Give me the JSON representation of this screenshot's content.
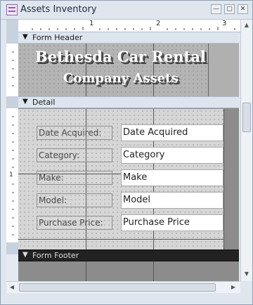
{
  "window": {
    "title": "Assets Inventory"
  },
  "window_controls": {
    "minimize": "—",
    "restore": "▢",
    "close": "✕"
  },
  "ruler": {
    "top_marks": [
      "1",
      "2",
      "3"
    ],
    "left_marks": [
      "1"
    ]
  },
  "sections": {
    "header": "Form Header",
    "detail": "Detail",
    "footer": "Form Footer"
  },
  "header": {
    "company_name": "Bethesda Car Rental",
    "subtitle": "Company Assets"
  },
  "fields": [
    {
      "label": "Date Acquired:",
      "control": "Date Acquired"
    },
    {
      "label": "Category:",
      "control": "Category"
    },
    {
      "label": "Make:",
      "control": "Make"
    },
    {
      "label": "Model:",
      "control": "Model"
    },
    {
      "label": "Purchase Price:",
      "control": "Purchase Price"
    }
  ]
}
